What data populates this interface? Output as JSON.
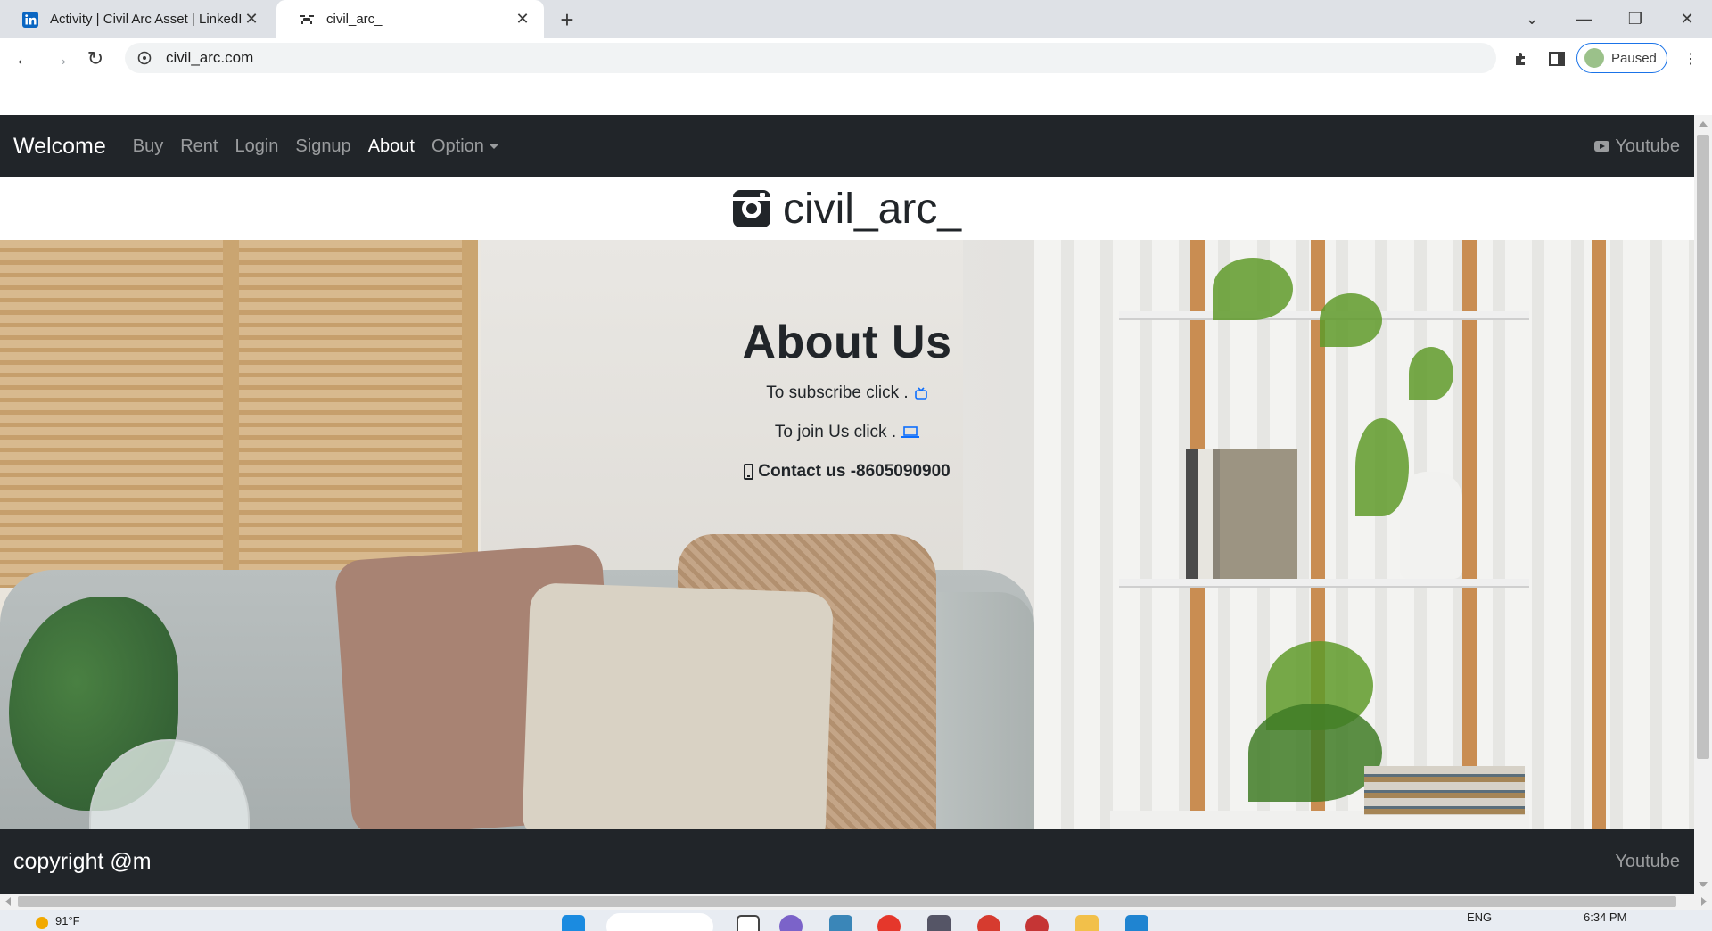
{
  "browser": {
    "tabs": [
      {
        "title": "Activity | Civil Arc Asset | LinkedIn",
        "icon": "linkedin-icon",
        "active": false
      },
      {
        "title": "civil_arc_",
        "icon": "drone-icon",
        "active": true
      }
    ],
    "address": "civil_arc.com",
    "profile_status": "Paused"
  },
  "navbar": {
    "brand": "Welcome",
    "links": [
      "Buy",
      "Rent",
      "Login",
      "Signup",
      "About",
      "Option"
    ],
    "active": "About",
    "right_link": "Youtube"
  },
  "handle": {
    "icon": "instagram-icon",
    "text": "civil_arc_"
  },
  "hero": {
    "title": "About Us",
    "subscribe_text": "To subscribe click .",
    "join_text": "To join Us click .",
    "contact_text": "Contact us -8605090900"
  },
  "footer": {
    "copyright": "copyright @m",
    "link": "Youtube"
  },
  "taskbar": {
    "weather": "91°F",
    "language": "ENG",
    "time": "6:34 PM"
  },
  "colors": {
    "navbar_bg": "#212529",
    "link_blue": "#0d6efd",
    "chrome_bg": "#dee1e6",
    "profile_border": "#1a73e8"
  }
}
